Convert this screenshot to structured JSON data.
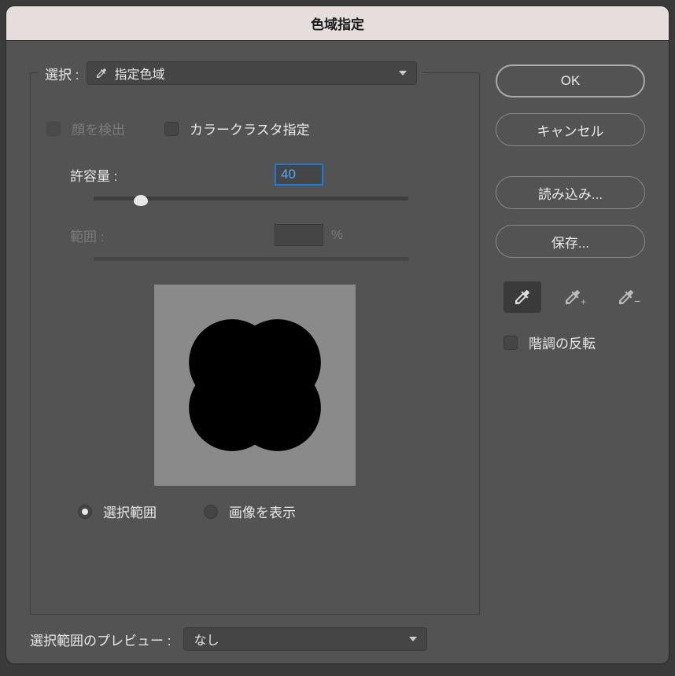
{
  "title": "色域指定",
  "select": {
    "label": "選択 :",
    "value": "指定色域"
  },
  "checkboxes": {
    "detect_faces": "顔を検出",
    "color_clusters": "カラークラスタ指定"
  },
  "fuzziness": {
    "label": "許容量 :",
    "value": "40"
  },
  "range": {
    "label": "範囲 :",
    "suffix": "%"
  },
  "radios": {
    "selection": "選択範囲",
    "image": "画像を表示"
  },
  "buttons": {
    "ok": "OK",
    "cancel": "キャンセル",
    "load": "読み込み...",
    "save": "保存..."
  },
  "invert": "階調の反転",
  "preview": {
    "label": "選択範囲のプレビュー :",
    "value": "なし"
  }
}
